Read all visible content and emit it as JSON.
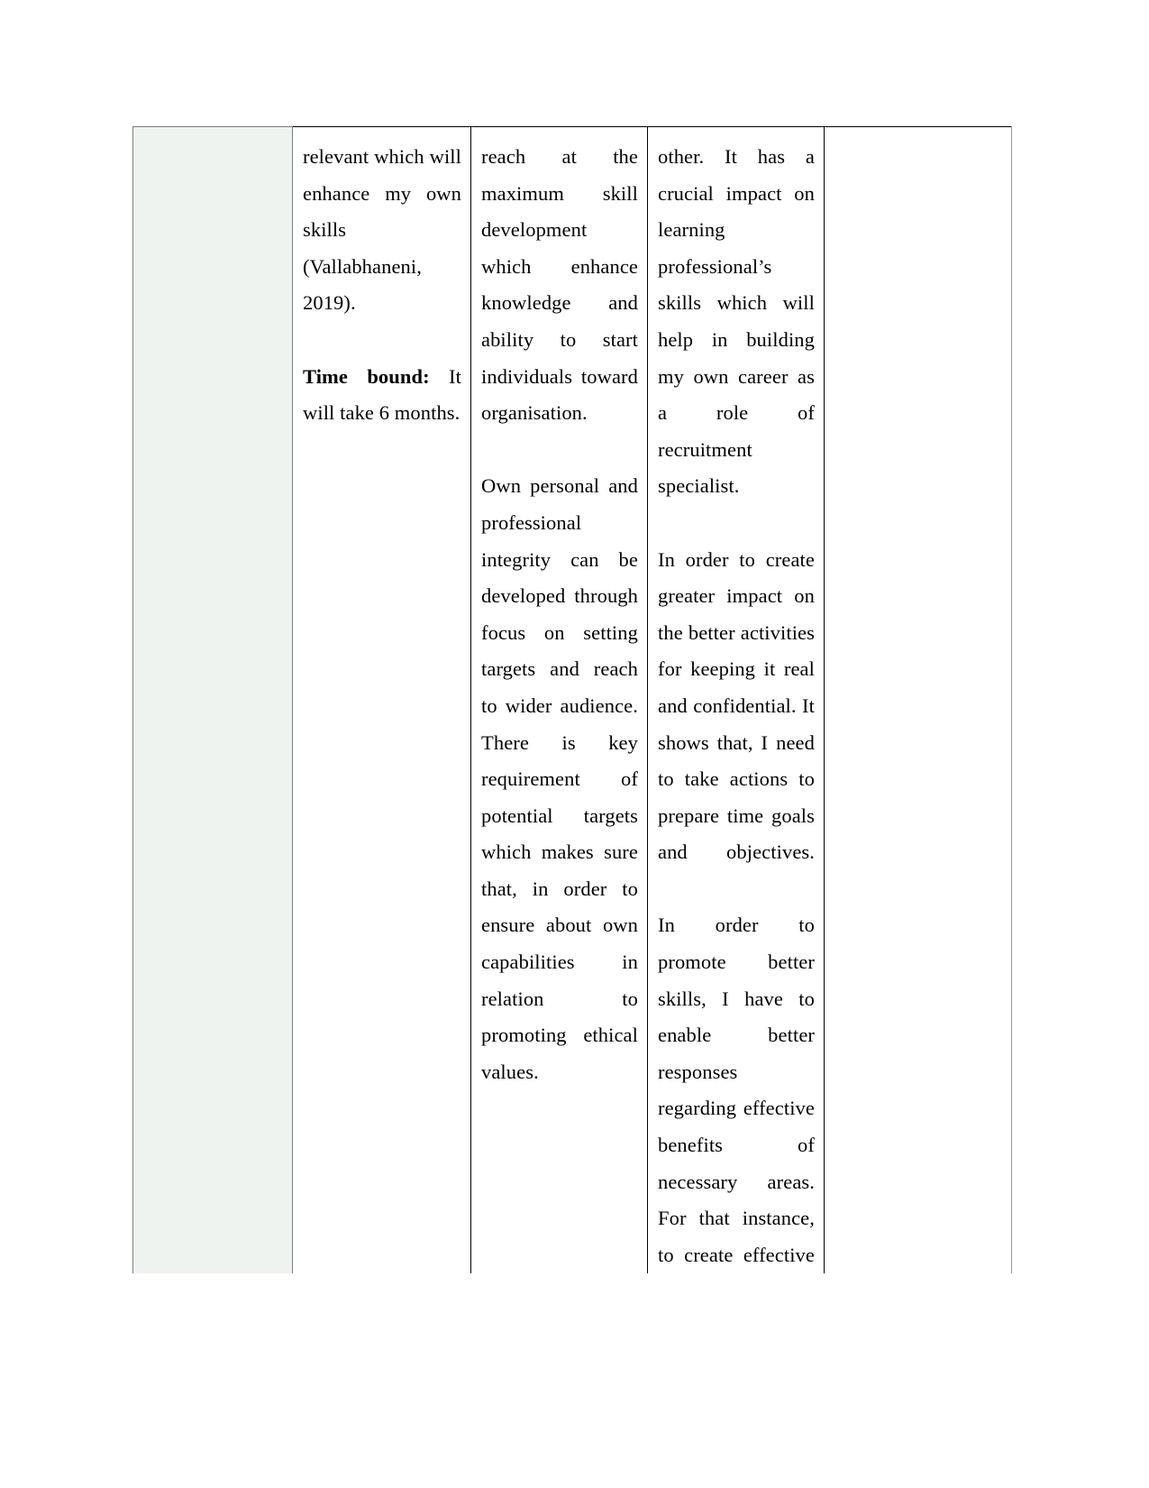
{
  "document": {
    "type": "table-continuation-page",
    "page_background": "#ffffff",
    "table": {
      "border_color": "#000000",
      "shaded_cell_fill": "#eef3ef",
      "shaded_cell_border": "#7d7d7d",
      "columns": 5
    }
  },
  "cells": {
    "col1_shaded": "",
    "col2": {
      "para1_part_a": "relevant which will enhance my own skills (Vallabhaneni, 2019).",
      "para2_label": "Time bound:",
      "para2_rest": " It will take 6 months."
    },
    "col3": {
      "para1": "reach at the maximum skill development which enhance knowledge and ability to start individuals toward organisation.",
      "para2": "Own personal and professional integrity can be developed through focus on setting targets and reach to wider audience. There is key requirement of potential targets which makes sure that, in order to ensure about own capabilities in relation to promoting ethical values."
    },
    "col4": {
      "para1": "other. It has a crucial impact on learning professional’s skills which will help in building my own career as a role of recruitment specialist.",
      "para2": "In order to create greater impact on the better activities for keeping it real and confidential. It shows that, I need to take actions to prepare time goals and objectives.",
      "para3": "In order to promote better skills, I have to enable better responses regarding effective benefits of necessary areas. For that instance, to create effective growth"
    },
    "col5_empty": ""
  }
}
